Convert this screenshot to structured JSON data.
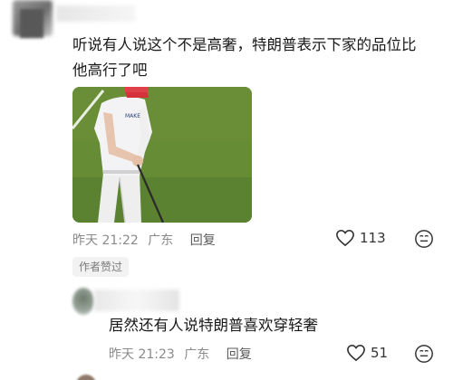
{
  "comment1": {
    "text_line1": "听说有人说这个不是高奢，特朗普表示下家的品位比",
    "text_line2": "他高行了吧",
    "time": "昨天 21:22",
    "location": "广东",
    "reply_label": "回复",
    "likes": "113",
    "author_liked_badge": "作者赞过"
  },
  "reply1": {
    "text": "居然还有人说特朗普喜欢穿轻奢",
    "time": "昨天 21:23",
    "location": "广东",
    "reply_label": "回复",
    "likes": "51"
  },
  "icons": {
    "like": "heart-outline-icon",
    "more": "more-dots-circle-icon"
  },
  "colors": {
    "text": "#1a1a1a",
    "meta": "#8a8a8a",
    "badge_bg": "#f2f2f2"
  }
}
